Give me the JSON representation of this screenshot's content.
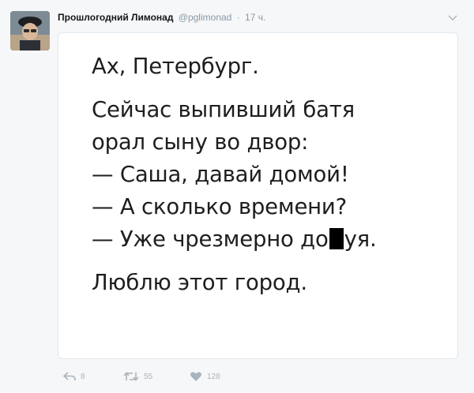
{
  "author": {
    "display_name": "Прошлогодний Лимонад",
    "handle": "@pglimonad",
    "separator": "·",
    "time": "17 ч."
  },
  "icons": {
    "menu": "chevron-down-icon",
    "reply": "reply-icon",
    "retweet": "retweet-icon",
    "like": "heart-icon"
  },
  "media": {
    "line1": "Ах, Петербург.",
    "line2": "Сейчас выпивший батя",
    "line3": "орал сыну во двор:",
    "line4": "— Саша, давай домой!",
    "line5": "— А сколько времени?",
    "line6_before": "— Уже чрезмерно до",
    "line6_after": "уя.",
    "line7": "Люблю этот город."
  },
  "actions": {
    "reply_count": "8",
    "retweet_count": "55",
    "like_count": "128"
  },
  "colors": {
    "accent_gray": "#8899a6",
    "icon_gray": "#a8b4bd",
    "text": "#14171a"
  }
}
